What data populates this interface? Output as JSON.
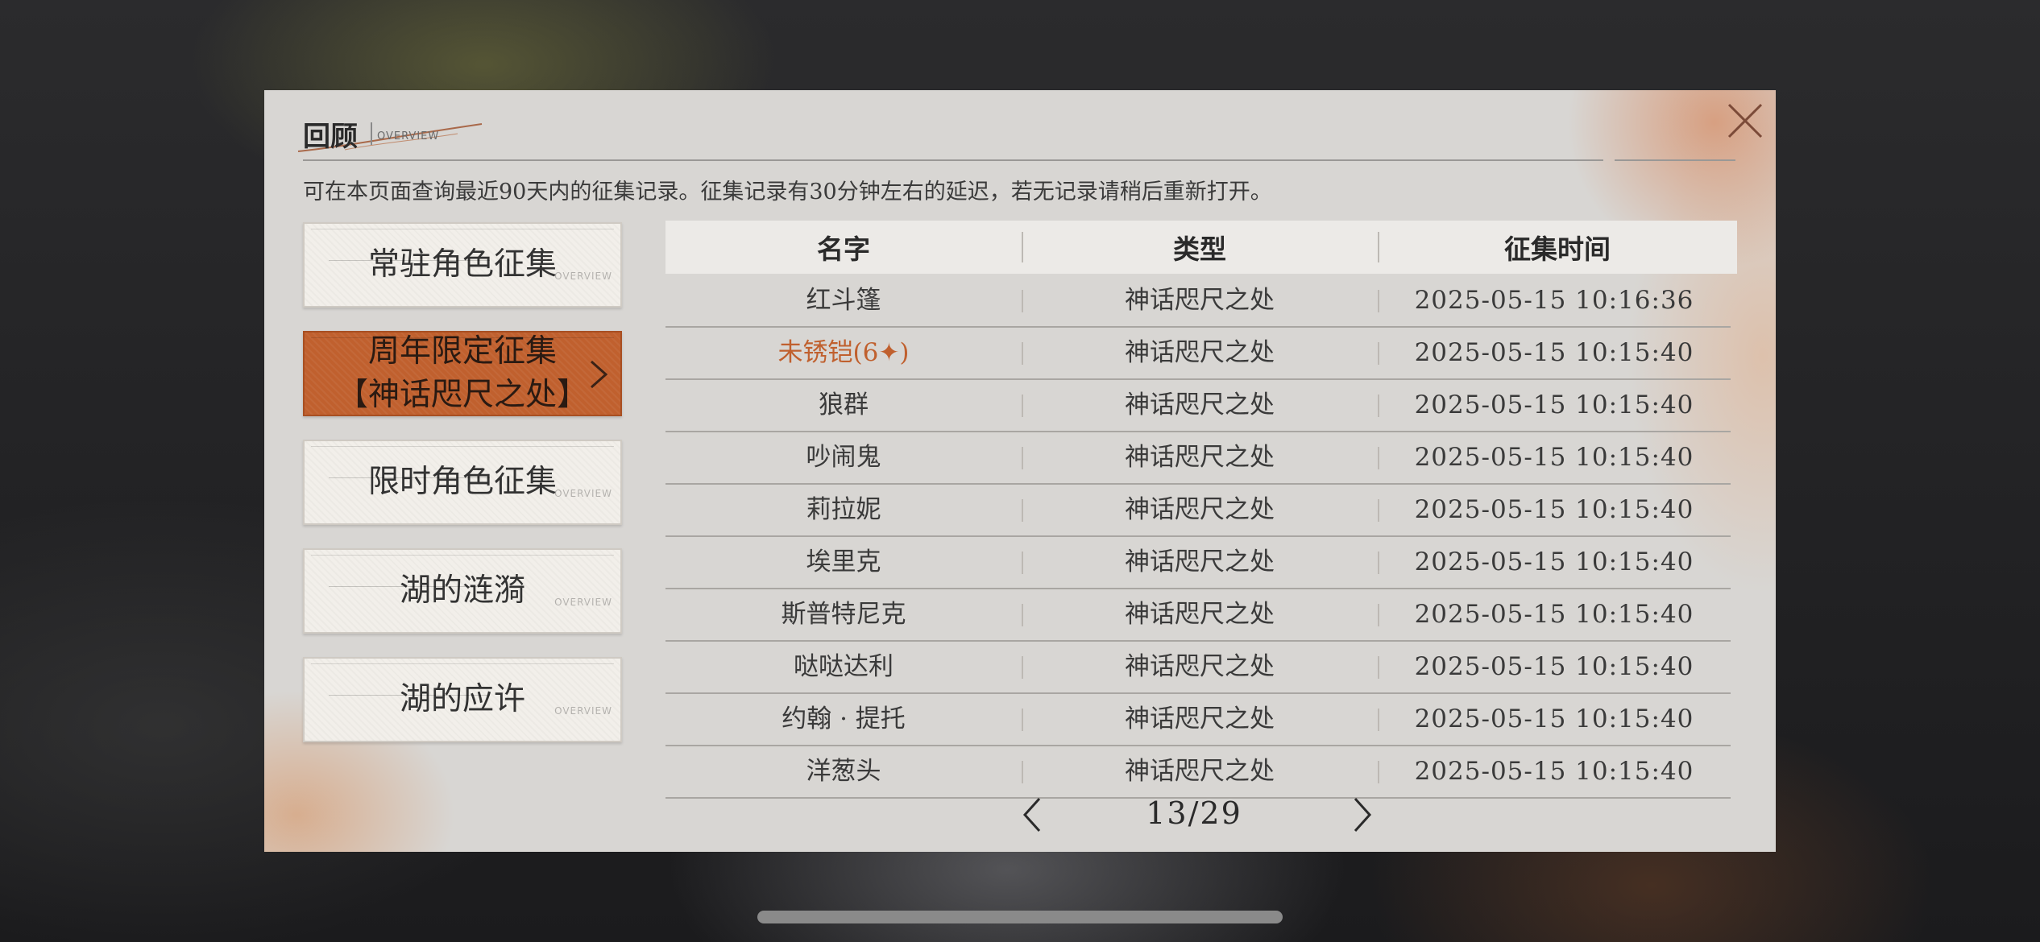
{
  "dialog": {
    "title": "回顾",
    "subtitle": "OVERVIEW",
    "notice": "可在本页面查询最近90天内的征集记录。征集记录有30分钟左右的延迟，若无记录请稍后重新打开。",
    "close_icon": "close-icon"
  },
  "categories": [
    {
      "label": "常驻角色征集",
      "active": false
    },
    {
      "label": "周年限定征集\n【神话咫尺之处】",
      "active": true
    },
    {
      "label": "限时角色征集",
      "active": false
    },
    {
      "label": "湖的涟漪",
      "active": false
    },
    {
      "label": "湖的应许",
      "active": false
    }
  ],
  "category_deco_text": "OVERVIEW",
  "table": {
    "headers": {
      "name": "名字",
      "type": "类型",
      "time": "征集时间"
    },
    "rows": [
      {
        "name": "红斗篷",
        "type": "神话咫尺之处",
        "time": "2025-05-15 10:16:36",
        "highlight": false
      },
      {
        "name": "未锈铠(6✦)",
        "type": "神话咫尺之处",
        "time": "2025-05-15 10:15:40",
        "highlight": true
      },
      {
        "name": "狼群",
        "type": "神话咫尺之处",
        "time": "2025-05-15 10:15:40",
        "highlight": false
      },
      {
        "name": "吵闹鬼",
        "type": "神话咫尺之处",
        "time": "2025-05-15 10:15:40",
        "highlight": false
      },
      {
        "name": "莉拉妮",
        "type": "神话咫尺之处",
        "time": "2025-05-15 10:15:40",
        "highlight": false
      },
      {
        "name": "埃里克",
        "type": "神话咫尺之处",
        "time": "2025-05-15 10:15:40",
        "highlight": false
      },
      {
        "name": "斯普特尼克",
        "type": "神话咫尺之处",
        "time": "2025-05-15 10:15:40",
        "highlight": false
      },
      {
        "name": "哒哒达利",
        "type": "神话咫尺之处",
        "time": "2025-05-15 10:15:40",
        "highlight": false
      },
      {
        "name": "约翰 · 提托",
        "type": "神话咫尺之处",
        "time": "2025-05-15 10:15:40",
        "highlight": false
      },
      {
        "name": "洋葱头",
        "type": "神话咫尺之处",
        "time": "2025-05-15 10:15:40",
        "highlight": false
      }
    ]
  },
  "pager": {
    "text": "13/29",
    "prev_icon": "chevron-left-icon",
    "next_icon": "chevron-right-icon"
  },
  "colors": {
    "accent": "#c0602e",
    "panel": "#d8d6d3",
    "button": "#f2efea"
  }
}
